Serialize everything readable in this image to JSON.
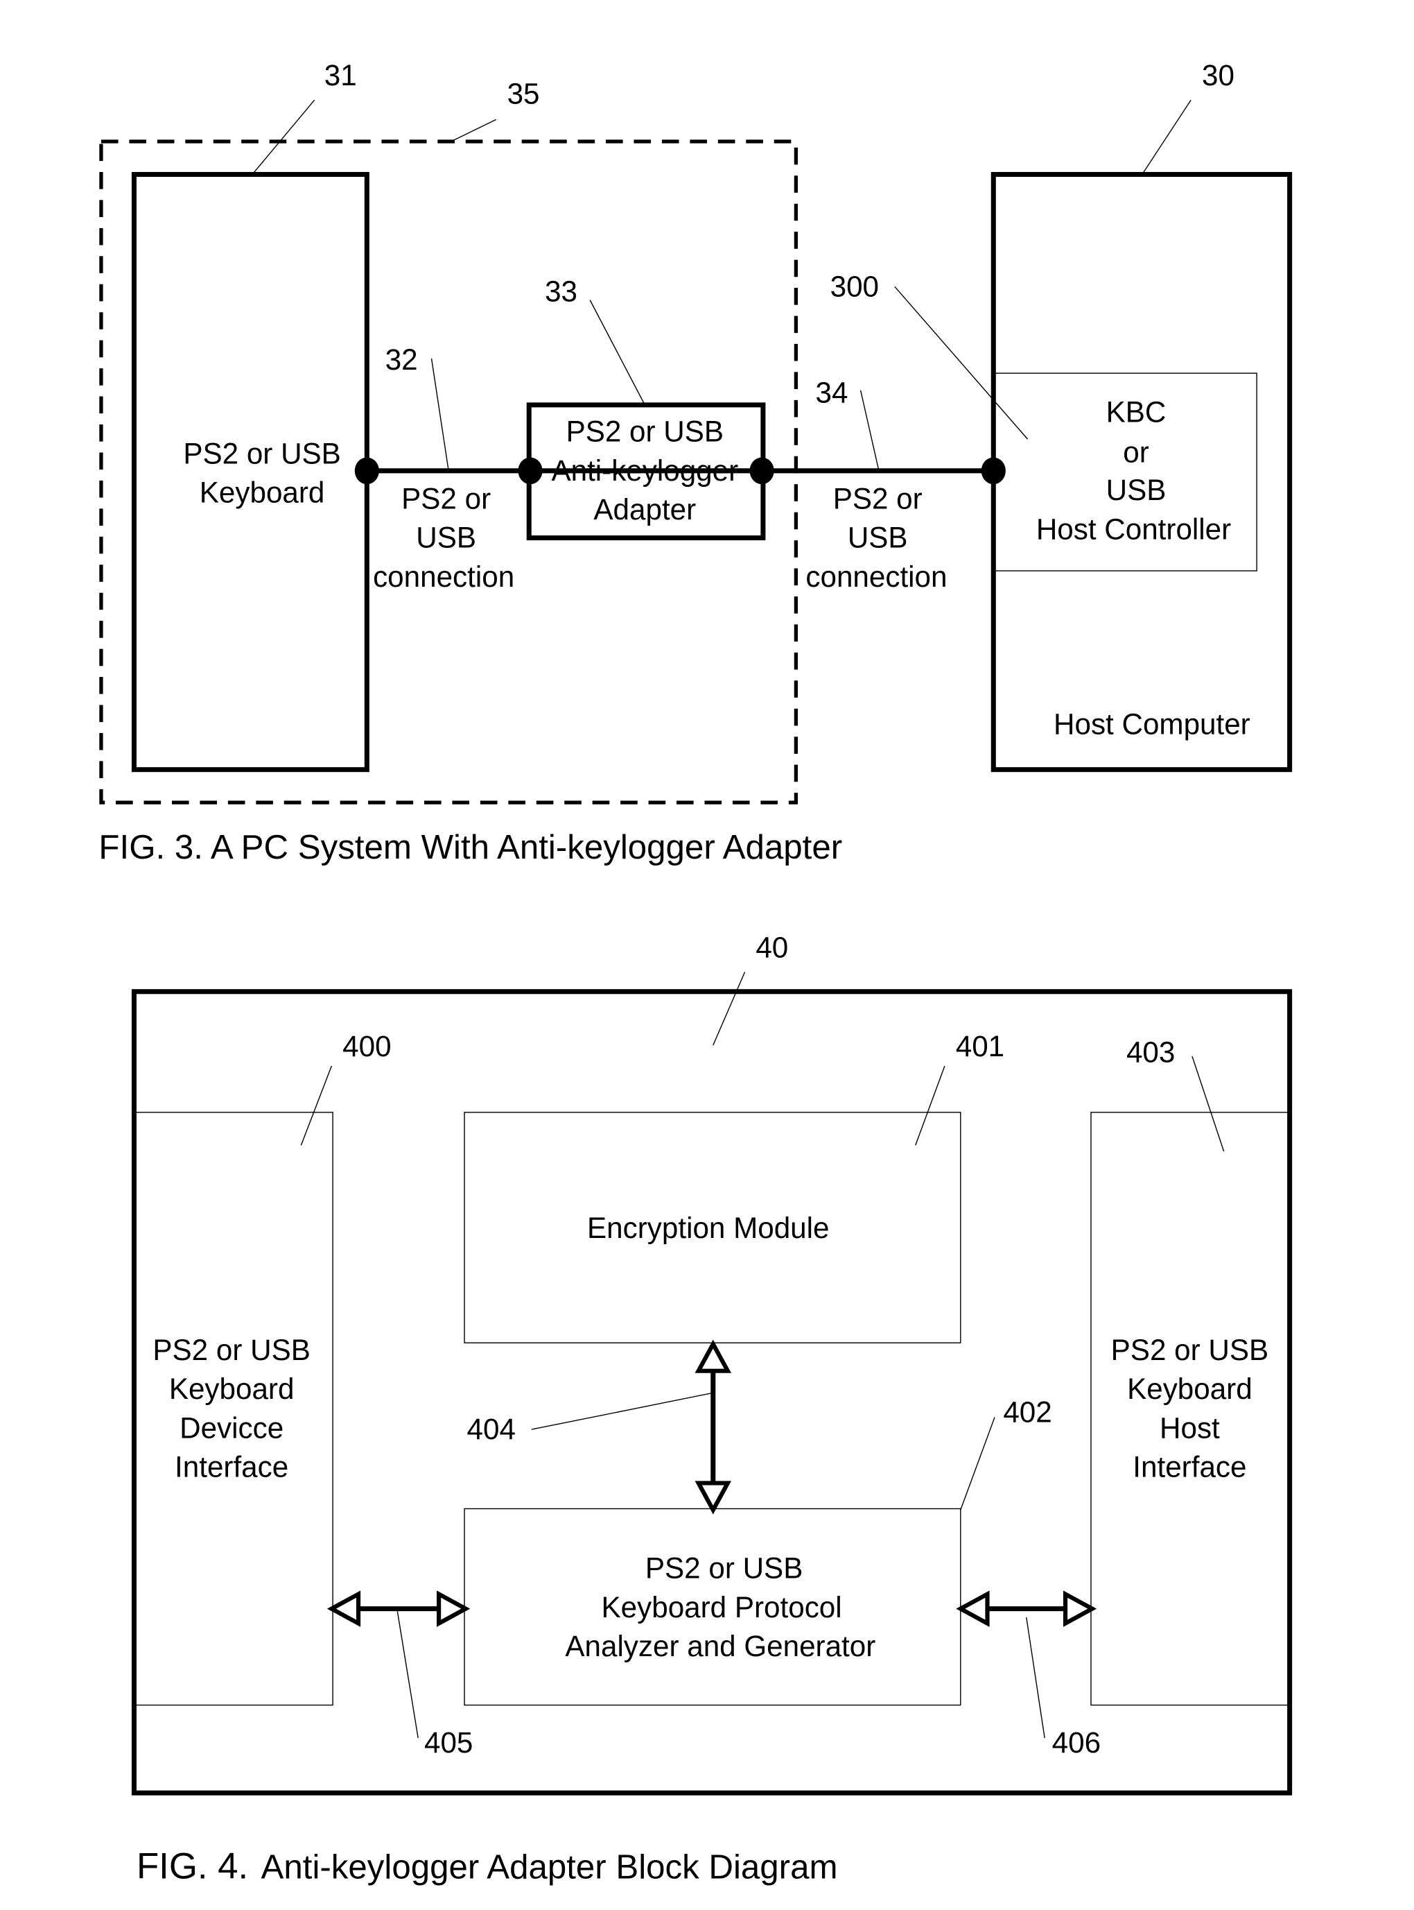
{
  "fig3": {
    "caption": "FIG. 3. A PC System With Anti-keylogger Adapter",
    "refs": {
      "keyboard": "31",
      "dashed_group": "35",
      "host": "30",
      "adapter": "33",
      "conn_left": "32",
      "conn_right": "34",
      "host_controller": "300"
    },
    "keyboard_label": [
      "PS2 or USB",
      "Keyboard"
    ],
    "adapter_label": [
      "PS2 or USB",
      "Anti-keylogger",
      "Adapter"
    ],
    "conn_left_label": [
      "PS2 or",
      "USB",
      "connection"
    ],
    "conn_right_label": [
      "PS2 or",
      "USB",
      "connection"
    ],
    "controller_label": [
      "KBC",
      "or",
      "USB",
      "Host Controller"
    ],
    "host_label": "Host Computer"
  },
  "fig4": {
    "caption_prefix": "FIG. 4.",
    "caption_text": "Anti-keylogger Adapter Block Diagram",
    "refs": {
      "adapter": "40",
      "device_interface": "400",
      "encryption": "401",
      "protocol": "402",
      "host_interface": "403",
      "arrow_vertical": "404",
      "arrow_left": "405",
      "arrow_right": "406"
    },
    "device_interface_label": [
      "PS2 or USB",
      "Keyboard",
      "Devicce",
      "Interface"
    ],
    "encryption_label": "Encryption Module",
    "protocol_label": [
      "PS2 or USB",
      "Keyboard Protocol",
      "Analyzer and Generator"
    ],
    "host_interface_label": [
      "PS2 or USB",
      "Keyboard",
      "Host",
      "Interface"
    ]
  }
}
